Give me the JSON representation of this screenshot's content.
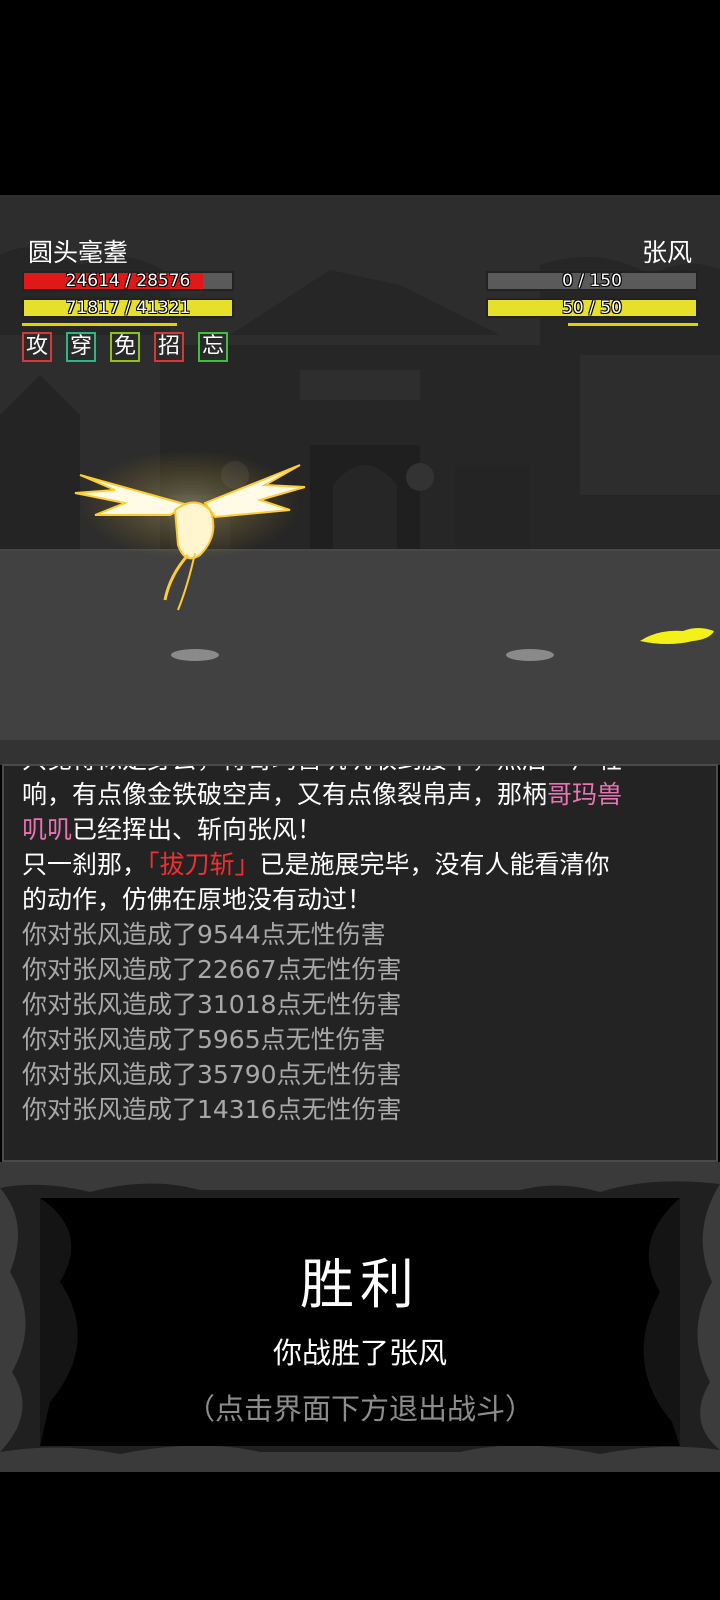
{
  "player": {
    "name": "圆头毫耋",
    "hp_text": "24614 / 28576",
    "hp_fraction": 0.861,
    "mp_text": "71817 / 41321",
    "mp_fraction": 1.0,
    "hp_color": "#e01818",
    "mp_color": "#e6e02a"
  },
  "enemy": {
    "name": "张风",
    "hp_text": "0 / 150",
    "hp_fraction": 0.0,
    "mp_text": "50 / 50",
    "mp_fraction": 1.0
  },
  "buffs": [
    {
      "label": "攻",
      "border": "#d23a3a"
    },
    {
      "label": "穿",
      "border": "#2fb38a"
    },
    {
      "label": "免",
      "border": "#8fc21f"
    },
    {
      "label": "招",
      "border": "#d23a3a"
    },
    {
      "label": "忘",
      "border": "#3fbf3f"
    }
  ],
  "log": {
    "line0": "只觉得似是身去，待哥玛兽叽叽收到腰中，然后一声轻",
    "line1": "响，有点像金铁破空声，又有点像裂帛声，那柄",
    "line1_highlight": "哥玛兽",
    "line2_highlight": "叽叽",
    "line2": "已经挥出、斩向张风！",
    "line3a": "只一刹那，",
    "line3_skill": "「拔刀斩」",
    "line3b": "已是施展完毕，没有人能看清你",
    "line4": "的动作，仿佛在原地没有动过！",
    "damage": [
      "你对张风造成了9544点无性伤害",
      "你对张风造成了22667点无性伤害",
      "你对张风造成了31018点无性伤害",
      "你对张风造成了5965点无性伤害",
      "你对张风造成了35790点无性伤害",
      "你对张风造成了14316点无性伤害"
    ]
  },
  "result": {
    "title": "胜利",
    "subtitle": "你战胜了张风",
    "hint": "（点击界面下方退出战斗）"
  }
}
